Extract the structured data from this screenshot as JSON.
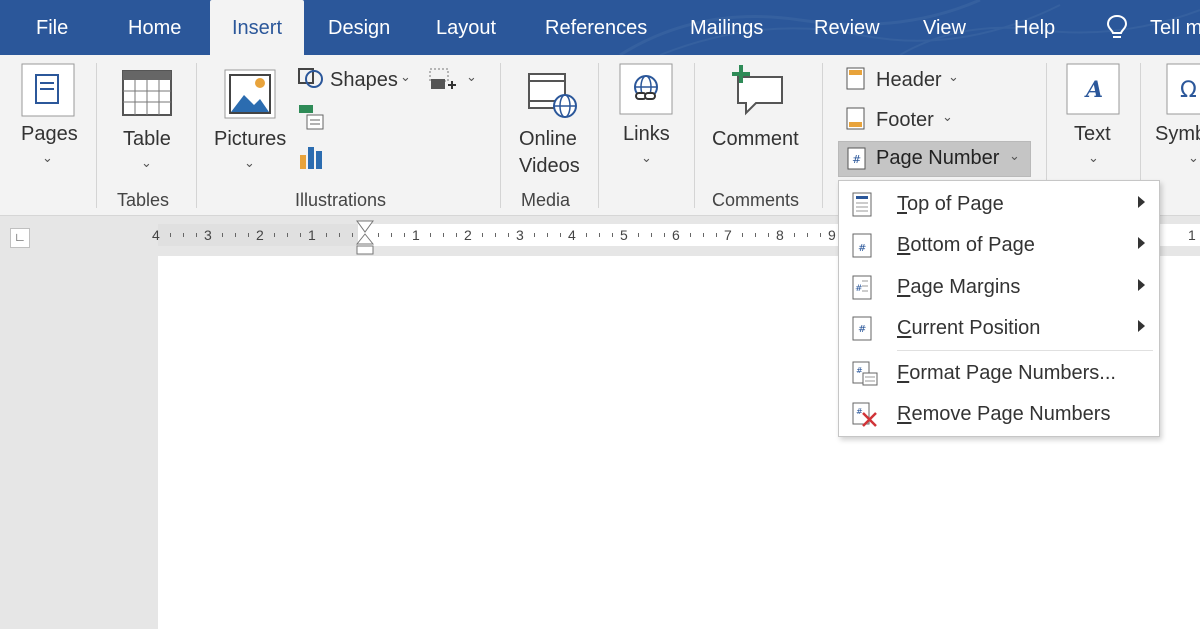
{
  "tabs": [
    {
      "label": "File",
      "active": false
    },
    {
      "label": "Home",
      "active": false
    },
    {
      "label": "Insert",
      "active": true
    },
    {
      "label": "Design",
      "active": false
    },
    {
      "label": "Layout",
      "active": false
    },
    {
      "label": "References",
      "active": false
    },
    {
      "label": "Mailings",
      "active": false
    },
    {
      "label": "Review",
      "active": false
    },
    {
      "label": "View",
      "active": false
    },
    {
      "label": "Help",
      "active": false
    }
  ],
  "tell_me": "Tell m",
  "ribbon": {
    "pages": "Pages",
    "table": "Table",
    "group_tables": "Tables",
    "pictures": "Pictures",
    "shapes": "Shapes",
    "group_illustrations": "Illustrations",
    "online_videos_line1": "Online",
    "online_videos_line2": "Videos",
    "group_media": "Media",
    "links": "Links",
    "comment": "Comment",
    "group_comments": "Comments",
    "header": "Header",
    "footer": "Footer",
    "page_number": "Page Number",
    "text": "Text",
    "symbols": "Symb"
  },
  "ruler": {
    "left_numbers": [
      "4",
      "3",
      "2",
      "1"
    ],
    "right_numbers": [
      "1",
      "2",
      "3",
      "4",
      "5",
      "6",
      "7",
      "8",
      "9"
    ],
    "far_right": "1"
  },
  "page_number_menu": {
    "items": [
      {
        "first": "T",
        "rest": "op of Page",
        "submenu": true
      },
      {
        "first": "B",
        "rest": "ottom of Page",
        "submenu": true
      },
      {
        "first": "P",
        "rest": "age Margins",
        "submenu": true
      },
      {
        "first": "C",
        "rest": "urrent Position",
        "submenu": true
      },
      {
        "first": "F",
        "rest": "ormat Page Numbers...",
        "submenu": false
      },
      {
        "first": "R",
        "rest": "emove Page Numbers",
        "submenu": false
      }
    ]
  },
  "colors": {
    "tab_bar": "#2b579a",
    "ribbon": "#f3f3f3",
    "accent_blue": "#2b579a",
    "comment_green": "#2e8b57",
    "remove_red": "#d13438"
  }
}
